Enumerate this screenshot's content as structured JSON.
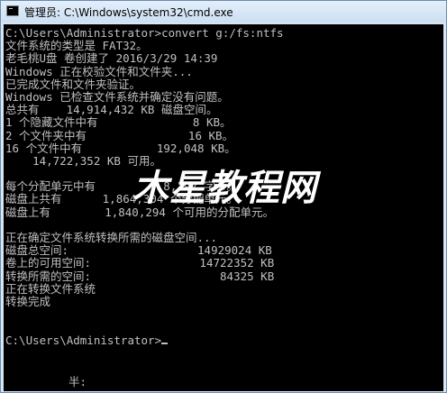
{
  "window": {
    "title": "管理员: C:\\Windows\\system32\\cmd.exe",
    "app_icon": "cmd-icon"
  },
  "console": {
    "lines": [
      "C:\\Users\\Administrator>convert g:/fs:ntfs",
      "文件系统的类型是 FAT32。",
      "老毛桃U盘 卷创建了 2016/3/29 14:39",
      "Windows 正在校验文件和文件夹...",
      "已完成文件和文件夹验证。",
      "Windows 已检查文件系统并确定没有问题。",
      "总共有    14,914,432 KB 磁盘空间。",
      "1 个隐藏文件中有              8 KB。",
      "2 个文件夹中有               16 KB。",
      "16 个文件中有           192,048 KB。",
      "    14,722,352 KB 可用。",
      "",
      "每个分配单元中有          8,192 字节。",
      "磁盘上共有      1,864,304 个分配单元。",
      "磁盘上有        1,840,294 个可用的分配单元。",
      "",
      "正在确定文件系统转换所需的磁盘空间...",
      "磁盘总空间:                   14929024 KB",
      "卷上的可用空间:                14722352 KB",
      "转换所需的空间:                   84325 KB",
      "正在转换文件系统",
      "转换完成",
      "",
      "",
      "C:\\Users\\Administrator>"
    ],
    "ime_text": "半:"
  },
  "watermark": "木星教程网"
}
